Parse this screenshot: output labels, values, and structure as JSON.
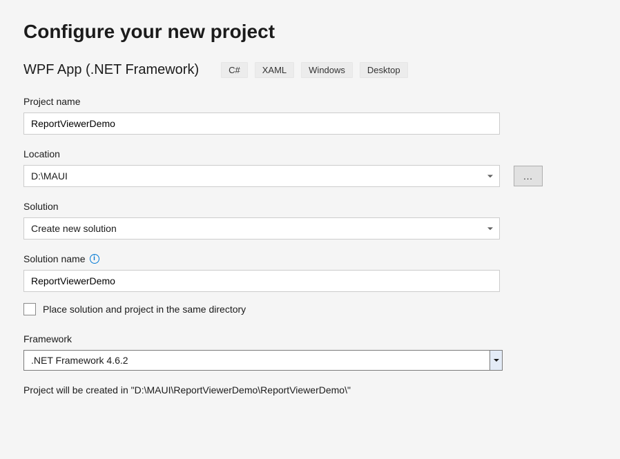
{
  "page_title": "Configure your new project",
  "template": {
    "name": "WPF App (.NET Framework)",
    "tags": [
      "C#",
      "XAML",
      "Windows",
      "Desktop"
    ]
  },
  "fields": {
    "project_name": {
      "label": "Project name",
      "value": "ReportViewerDemo"
    },
    "location": {
      "label": "Location",
      "value": "D:\\MAUI",
      "browse_label": "..."
    },
    "solution": {
      "label": "Solution",
      "value": "Create new solution"
    },
    "solution_name": {
      "label": "Solution name",
      "value": "ReportViewerDemo"
    },
    "same_dir": {
      "label": "Place solution and project in the same directory",
      "checked": false
    },
    "framework": {
      "label": "Framework",
      "value": ".NET Framework 4.6.2"
    }
  },
  "summary": "Project will be created in \"D:\\MAUI\\ReportViewerDemo\\ReportViewerDemo\\\""
}
